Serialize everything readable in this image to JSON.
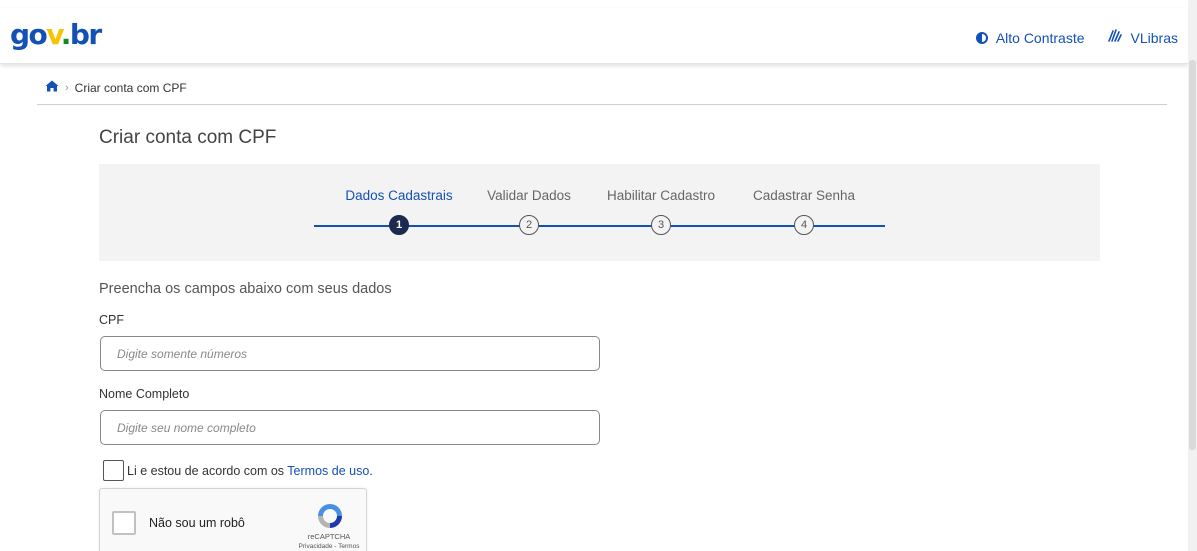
{
  "header": {
    "logo": {
      "part1": "go",
      "part2": "v",
      "part3": ".",
      "part4": "br"
    },
    "contrast_label": "Alto Contraste",
    "libras_label": "VLibras"
  },
  "breadcrumb": {
    "current": "Criar conta com CPF"
  },
  "page_title": "Criar conta com CPF",
  "steps": [
    {
      "label": "Dados Cadastrais",
      "number": "1",
      "state": "active"
    },
    {
      "label": "Validar Dados",
      "number": "2",
      "state": "pending"
    },
    {
      "label": "Habilitar Cadastro",
      "number": "3",
      "state": "pending"
    },
    {
      "label": "Cadastrar Senha",
      "number": "4",
      "state": "pending"
    }
  ],
  "form": {
    "instruction": "Preencha os campos abaixo com seus dados",
    "cpf": {
      "label": "CPF",
      "placeholder": "Digite somente números",
      "value": ""
    },
    "name": {
      "label": "Nome Completo",
      "placeholder": "Digite seu nome completo",
      "value": ""
    },
    "terms": {
      "text": "Li e estou de acordo com os ",
      "link": "Termos de uso",
      "suffix": ".",
      "checked": false
    }
  },
  "recaptcha": {
    "label": "Não sou um robô",
    "brand": "reCAPTCHA",
    "links": "Privacidade - Termos",
    "checked": false
  },
  "colors": {
    "brand_blue": "#1351b4",
    "logo_yellow": "#f8c300",
    "logo_green": "#168821",
    "active_step": "#1b2a4e",
    "panel_gray": "#f3f3f3"
  },
  "icons": {
    "home": "home-icon",
    "contrast": "contrast-icon",
    "libras": "hands-icon",
    "recaptcha": "recaptcha-logo-icon"
  }
}
